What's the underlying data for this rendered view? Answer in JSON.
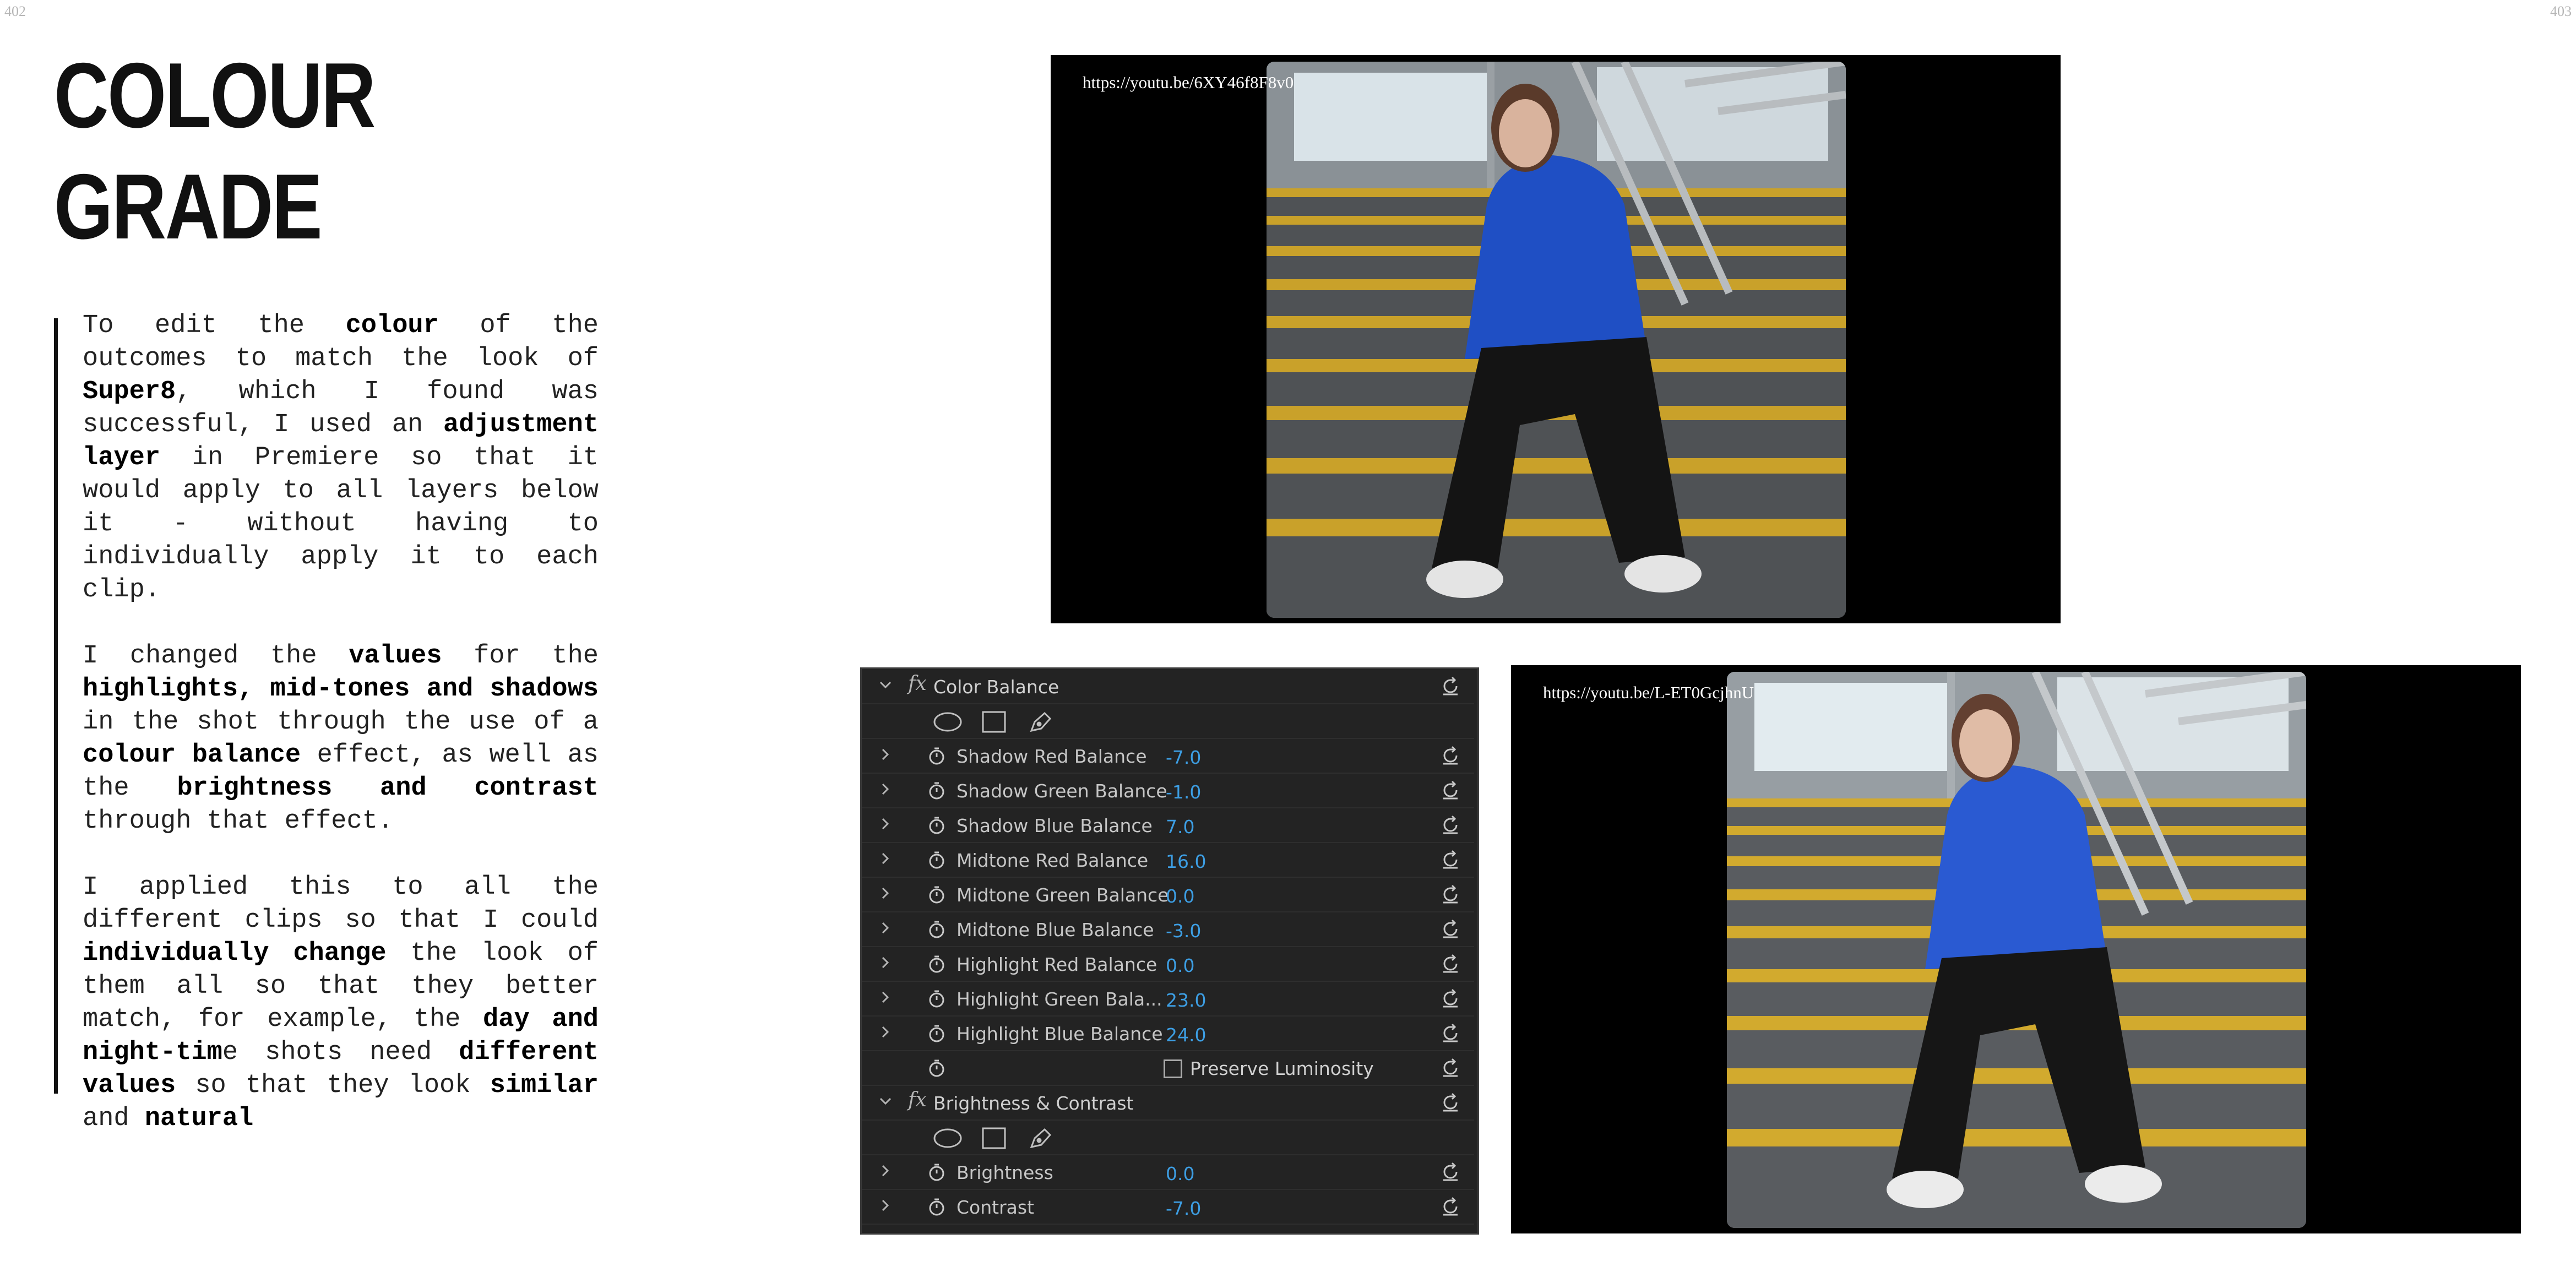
{
  "page_numbers": {
    "left": "402",
    "right": "403"
  },
  "title": {
    "line1": "COLOUR",
    "line2": "GRADE"
  },
  "body": {
    "p1": [
      {
        "t": "To edit the "
      },
      {
        "t": "colour",
        "b": true
      },
      {
        "t": " of the outcomes to match the look of "
      },
      {
        "t": "Super8",
        "b": true
      },
      {
        "t": ", which I found was successful, I used an "
      },
      {
        "t": "adjustment layer",
        "b": true
      },
      {
        "t": " in Premiere so that it would apply to all layers below it - without having to individually apply it to each clip."
      }
    ],
    "p2": [
      {
        "t": "I changed the "
      },
      {
        "t": "values",
        "b": true
      },
      {
        "t": " for the "
      },
      {
        "t": "highlights, mid-tones and shadows",
        "b": true
      },
      {
        "t": " in the shot through the use of a "
      },
      {
        "t": "colour balance",
        "b": true
      },
      {
        "t": " effect, as well as the "
      },
      {
        "t": "brightness and contrast",
        "b": true
      },
      {
        "t": " through that effect."
      }
    ],
    "p3": [
      {
        "t": "I applied this to all the different clips so that I could "
      },
      {
        "t": "individually change",
        "b": true
      },
      {
        "t": " the look of them all so that they better match, for example, the "
      },
      {
        "t": "day and night-tim",
        "b": true
      },
      {
        "t": "e shots need "
      },
      {
        "t": "different values",
        "b": true
      },
      {
        "t": " so that they look "
      },
      {
        "t": "similar",
        "b": true
      },
      {
        "t": " and "
      },
      {
        "t": "natural",
        "b": true
      }
    ]
  },
  "videos": {
    "top_url": "https://youtu.be/6XY46f8F8v0",
    "bottom_url": "https://youtu.be/L-ET0GcjhnU"
  },
  "effect_panel": {
    "color_balance": {
      "fx": "fx",
      "title": "Color Balance",
      "params": [
        {
          "label": "Shadow Red Balance",
          "value": "-7.0"
        },
        {
          "label": "Shadow Green Balance",
          "value": "-1.0"
        },
        {
          "label": "Shadow Blue Balance",
          "value": "7.0"
        },
        {
          "label": "Midtone Red Balance",
          "value": "16.0"
        },
        {
          "label": "Midtone Green Balance",
          "value": "0.0"
        },
        {
          "label": "Midtone Blue Balance",
          "value": "-3.0"
        },
        {
          "label": "Highlight Red Balance",
          "value": "0.0"
        },
        {
          "label": "Highlight Green Bala...",
          "value": "23.0"
        },
        {
          "label": "Highlight Blue Balance",
          "value": "24.0"
        }
      ],
      "preserve_luminosity": {
        "label": "Preserve Luminosity",
        "checked": false
      }
    },
    "brightness_contrast": {
      "fx": "fx",
      "title": "Brightness & Contrast",
      "params": [
        {
          "label": "Brightness",
          "value": "0.0"
        },
        {
          "label": "Contrast",
          "value": "-7.0"
        }
      ]
    },
    "value_color": "#3d9ee3"
  }
}
